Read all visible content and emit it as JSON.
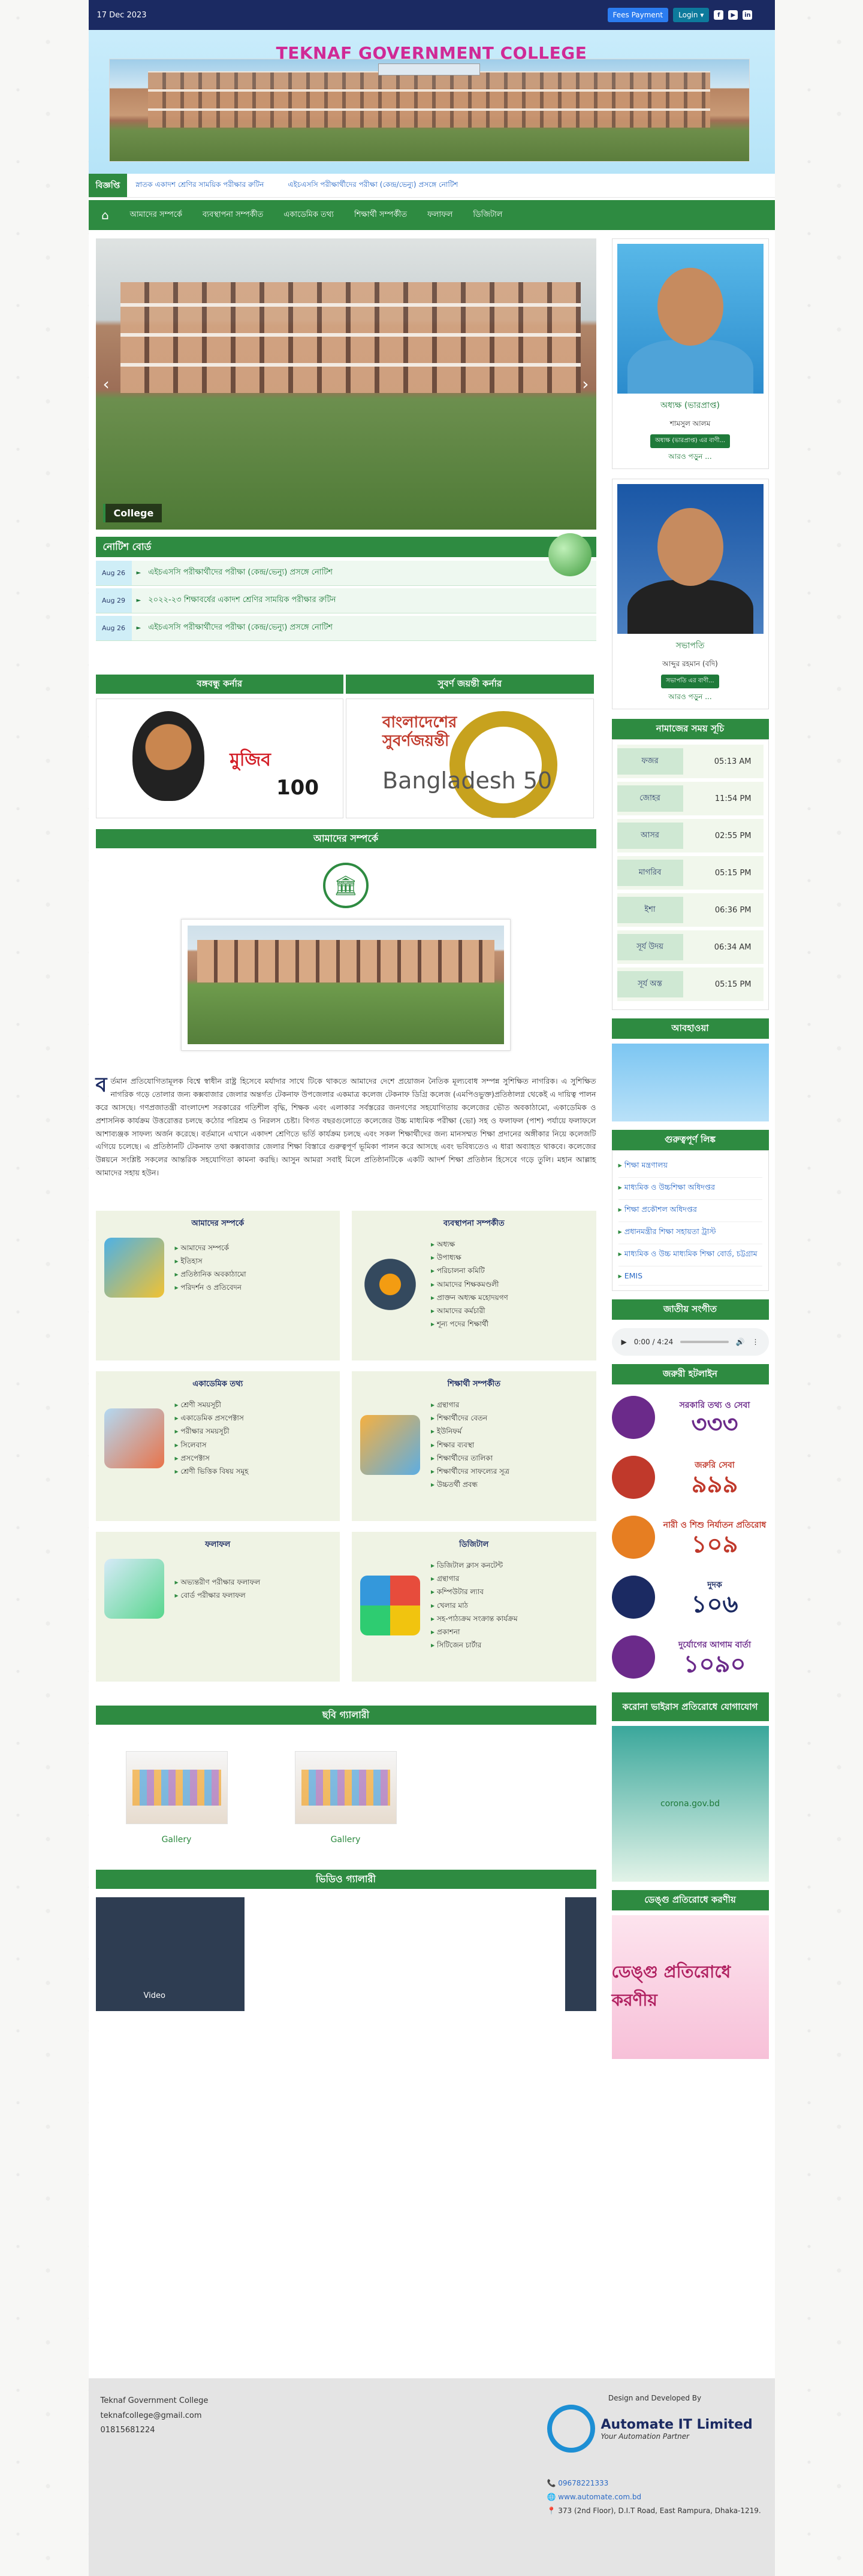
{
  "topbar": {
    "date": "17 Dec 2023",
    "fees_label": "Fees Payment",
    "login_label": "Login ▾",
    "social": [
      "f",
      "▶",
      "in"
    ]
  },
  "header": {
    "title": "TEKNAF GOVERNMENT COLLEGE"
  },
  "ticker": {
    "label": "বিজ্ঞপ্তি",
    "items": [
      "স্নাতক একাদশ শ্রেণির সাময়িক পরীক্ষার রুটিন",
      "এইচএসসি পরীক্ষার্থীদের পরীক্ষা (কেন্দ্র/ভেন্যু) প্রসঙ্গে নোটিশ"
    ]
  },
  "nav": {
    "items": [
      "আমাদের সম্পর্কে",
      "ব্যবস্থাপনা সম্পর্কীত",
      "একাডেমিক তথ্য",
      "শিক্ষার্থী সম্পর্কীত",
      "ফলাফল",
      "ডিজিটাল"
    ]
  },
  "slider": {
    "caption": "College"
  },
  "notice": {
    "title": "নোটিশ বোর্ড",
    "rows": [
      {
        "date": "Aug 26",
        "text": "এইচএসসি পরীক্ষার্থীদের পরীক্ষা (কেন্দ্র/ভেন্যু) প্রসঙ্গে নোটিশ"
      },
      {
        "date": "Aug 29",
        "text": "২০২২-২৩ শিক্ষাবর্ষের একাদশ শ্রেণির সাময়িক পরীক্ষার রুটিন"
      },
      {
        "date": "Aug 26",
        "text": "এইচএসসি পরীক্ষার্থীদের পরীক্ষা (কেন্দ্র/ভেন্যু) প্রসঙ্গে নোটিশ"
      }
    ]
  },
  "corners": {
    "left_title": "বঙ্গবন্ধু কর্নার",
    "right_title": "সুবর্ণ জয়ন্তী কর্নার",
    "mujib_text": "মুজিব",
    "mujib_num": "100",
    "bd50_text": "বাংলাদেশের সুবর্ণজয়ন্তী",
    "bd50_word": "Bangladesh 50"
  },
  "about": {
    "title": "আমাদের সম্পর্কে",
    "drop_cap": "ব",
    "text": "র্তমান প্রতিযোগিতামূলক বিশ্বে স্বাধীন রাষ্ট্র হিসেবে মর্যাদার সাথে টিকে থাকতে আমাদের দেশে প্রয়োজন নৈতিক মূল্যবোধ সম্পন্ন সুশিক্ষিত নাগরিক। এ সুশিক্ষিত নাগরিক গড়ে তোলার জন্য কক্সবাজার জেলার অন্তর্গত টেকনাফ উপজেলার একমাত্র কলেজ টেকনাফ ডিগ্রি কলেজ (এমপিওভুক্ত)প্রতিষ্ঠালগ্ন থেকেই এ দায়িত্ব পালন করে আসছে। গণপ্রজাতন্ত্রী বাংলাদেশ সরকারের গতিশীল বৃদ্ধি, শিক্ষক এবং এলাকার সর্বস্তরের জনগণের সহযোগিতায় কলেজের ভৌত অবকাঠামো, একাডেমিক ও প্রশাসনিক কার্যক্রম উত্তরোত্তর চলছে কঠোর পরিশ্রম ও নিরলস চেষ্টা। বিগত বছরগুলোতে কলেজের উচ্চ মাধ্যমিক পরীক্ষা (ভো) সহ ও ফলাফল (পাশ) পর্যায়ে ফলাফলে আশাব্যঞ্জক সাফল্য অর্জন করেছে। বর্তমানে এখানে একাদশ শ্রেণিতে ভর্তি কার্যক্রম চলছে এবং সকল শিক্ষার্থীদের জন্য মানসম্মত শিক্ষা প্রদানের অঙ্গীকার নিয়ে কলেজটি এগিয়ে চলেছে। এ প্রতিষ্ঠানটি টেকনাফ তথা কক্সবাজার জেলার শিক্ষা বিস্তারে গুরুত্বপূর্ণ ভূমিকা পালন করে আসছে এবং ভবিষ্যতেও এ ধারা অব্যাহত থাকবে। কলেজের উন্নয়নে সংশ্লিষ্ট সকলের আন্তরিক সহযোগিতা কামনা করছি। আসুন আমরা সবাই মিলে প্রতিষ্ঠানটিকে একটি আদর্শ শিক্ষা প্রতিষ্ঠান হিসেবে গড়ে তুলি। মহান আল্লাহ আমাদের সহায় হউন।"
  },
  "cards": [
    {
      "title": "আমাদের সম্পর্কে",
      "items": [
        "আমাদের সম্পর্কে",
        "ইতিহাস",
        "প্রতিষ্ঠানিক অবকাঠামো",
        "পরিদর্শন ও প্রতিবেদন"
      ]
    },
    {
      "title": "ব্যবস্থাপনা সম্পর্কীত",
      "items": [
        "অধ্যক্ষ",
        "উপাধ্যক্ষ",
        "পরিচালনা কমিটি",
        "আমাদের শিক্ষকমণ্ডলী",
        "প্রাক্তন অধ্যক্ষ মহোদয়গণ",
        "আমাদের কর্মচারী",
        "শূন্য পদের শিক্ষার্থী"
      ]
    },
    {
      "title": "একাডেমিক তথ্য",
      "items": [
        "শ্রেণী সময়সূচী",
        "একাডেমিক প্রসপেক্টাস",
        "পরীক্ষার সময়সূচী",
        "সিলেবাস",
        "প্রসপেক্টাস",
        "শ্রেণী ভিত্তিক বিষয় সমূহ"
      ]
    },
    {
      "title": "শিক্ষার্থী সম্পর্কীত",
      "items": [
        "গ্রন্থাগার",
        "শিক্ষার্থীদের বেতন",
        "ইউনিফর্ম",
        "শিক্ষার ব্যবস্থা",
        "শিক্ষার্থীদের তালিকা",
        "শিক্ষার্থীদের সাফল্যের সূত্র",
        "উচ্চতর্থী প্রবন্ধ"
      ]
    },
    {
      "title": "ফলাফল",
      "items": [
        "অভ্যন্তরীণ পরীক্ষার ফলাফল",
        "বোর্ড পরীক্ষার ফলাফল"
      ]
    },
    {
      "title": "ডিজিটাল",
      "items": [
        "ডিজিটাল ক্লাস কনটেন্ট",
        "গ্রন্থাগার",
        "কম্পিউটার ল্যাব",
        "খেলার মাঠ",
        "সহ-পাঠ্যক্রম সংক্রান্ত কার্যক্রম",
        "প্রকাশনা",
        "সিটিজেন চার্টার"
      ]
    }
  ],
  "gallery": {
    "title": "ছবি গ্যালারী",
    "items": [
      "Gallery",
      "Gallery"
    ]
  },
  "video": {
    "title": "ভিডিও গ্যালারী",
    "caption": "Video"
  },
  "sidebar": {
    "principal": {
      "role": "অধ্যক্ষ (ভারপ্রাপ্ত)",
      "name": "শামসুল আলম",
      "badge": "অধ্যক্ষ (ভারপ্রাপ্ত) এর বাণী...",
      "more": "আরও পড়ুন ..."
    },
    "chair": {
      "role": "সভাপতি",
      "name": "আব্দুর রহমান (বদি)",
      "badge": "সভাপতি এর বাণী...",
      "more": "আরও পড়ুন ..."
    },
    "prayer_title": "নামাজের সময় সূচি",
    "prayer": [
      {
        "name": "ফজর",
        "time": "05:13 AM"
      },
      {
        "name": "জোহর",
        "time": "11:54 PM"
      },
      {
        "name": "আসর",
        "time": "02:55 PM"
      },
      {
        "name": "মাগরিব",
        "time": "05:15 PM"
      },
      {
        "name": "ইশা",
        "time": "06:36 PM"
      },
      {
        "name": "সূর্য উদয়",
        "time": "06:34 AM"
      },
      {
        "name": "সূর্য অস্ত",
        "time": "05:15 PM"
      }
    ],
    "weather_title": "আবহাওয়া",
    "links_title": "গুরুত্বপূর্ণ লিঙ্ক",
    "links": [
      "শিক্ষা মন্ত্রণালয়",
      "মাধ্যমিক ও উচ্চশিক্ষা অধিদপ্তর",
      "শিক্ষা প্রকৌশল অধিদপ্তর",
      "প্রধানমন্ত্রীর শিক্ষা সহায়তা ট্রাস্ট",
      "মাধ্যমিক ও উচ্চ মাধ্যমিক শিক্ষা বোর্ড, চট্টগ্রাম",
      "EMIS"
    ],
    "anthem_title": "জাতীয় সংগীত",
    "audio_time": "0:00 / 4:24",
    "hotline_title": "জরুরী হটলাইন",
    "hotlines": [
      {
        "label": "সরকারি তথ্য ও সেবা",
        "num": "৩৩৩",
        "color": "#6b2a8a"
      },
      {
        "label": "জরুরি সেবা",
        "num": "৯৯৯",
        "color": "#c0392b"
      },
      {
        "label": "নারী ও শিশু নির্যাতন প্রতিরোধ",
        "num": "১০৯",
        "color": "#c0392b"
      },
      {
        "label": "দুদক",
        "num": "১০৬",
        "color": "#1b2a62"
      },
      {
        "label": "দুর্যোগের আগাম বার্তা",
        "num": "১০৯০",
        "color": "#6b2a8a"
      }
    ],
    "corona_title": "করোনা ভাইরাস প্রতিরোধে যোগাযোগ",
    "corona_text": "corona.gov.bd",
    "dengue_title": "ডেঙ্গু প্রতিরোধে করণীয়",
    "dengue_text": "ডেঙ্গু প্রতিরোধে করণীয়"
  },
  "footer": {
    "college": "Teknaf Government College",
    "email": "teknafcollege@gmail.com",
    "phone": "01815681224",
    "designed": "Design and Developed By",
    "dev_name": "Automate IT Limited",
    "dev_sub": "Your Automation Partner",
    "dev_phone": "09678221333",
    "dev_web": "www.automate.com.bd",
    "dev_addr": "373 (2nd Floor), D.I.T Road, East Rampura, Dhaka-1219."
  }
}
